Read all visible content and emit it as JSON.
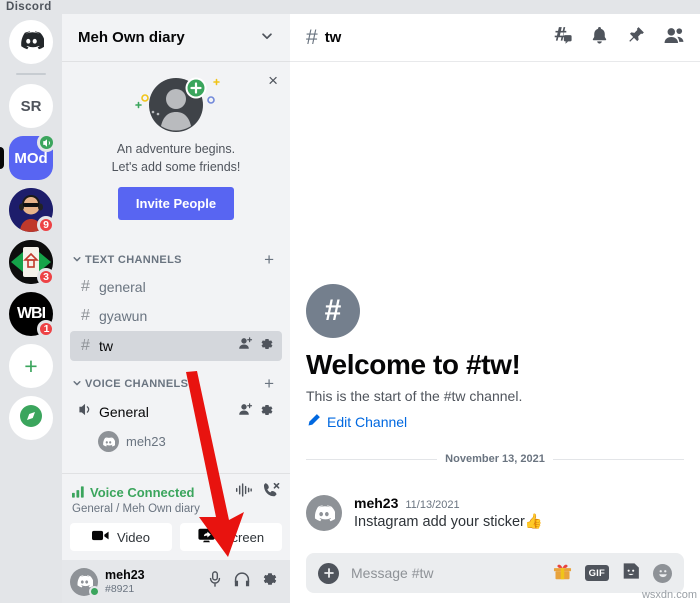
{
  "app": {
    "wordmark": "Discord",
    "watermark": "wsxdn.com"
  },
  "server_rail": {
    "home_icon": "discord-logo-icon",
    "items": [
      {
        "label": "SR",
        "style": "white",
        "badge": "",
        "voice_badge": false
      },
      {
        "label": "MOd",
        "style": "blurple",
        "badge": "",
        "voice_badge": true,
        "active": true
      },
      {
        "label": "",
        "style": "avatar-photo",
        "badge": "9",
        "voice_badge": false
      },
      {
        "label": "",
        "style": "avatar-home",
        "badge": "3",
        "voice_badge": false
      },
      {
        "label": "WBI",
        "style": "black",
        "badge": "1",
        "voice_badge": false
      }
    ],
    "add_server_label": "+",
    "explore_label": "compass-icon"
  },
  "sidebar": {
    "guild_name": "Meh Own diary",
    "guild_chevron": "chevron-down-icon",
    "promo": {
      "close": "×",
      "line1": "An adventure begins.",
      "line2": "Let's add some friends!",
      "button": "Invite People"
    },
    "categories": [
      {
        "label": "TEXT CHANNELS",
        "plus": "+",
        "channels": [
          {
            "name": "general",
            "prefix": "#",
            "active": false,
            "tools": false
          },
          {
            "name": "gyawun",
            "prefix": "#",
            "active": false,
            "tools": false
          },
          {
            "name": "tw",
            "prefix": "#",
            "active": true,
            "tools": true
          }
        ]
      },
      {
        "label": "VOICE CHANNELS",
        "plus": "+",
        "channels": [
          {
            "name": "General",
            "prefix": "speaker-icon",
            "active": false,
            "tools": true
          }
        ],
        "members": [
          {
            "name": "meh23"
          }
        ]
      }
    ],
    "voice_panel": {
      "status": "Voice Connected",
      "route": "General / Meh Own diary",
      "signal_icon": "signal-bars-icon",
      "ping_icon": "soundwave-icon",
      "disconnect_icon": "phone-hangup-icon",
      "buttons": [
        {
          "label": "Video",
          "icon": "camera-icon"
        },
        {
          "label": "Screen",
          "icon": "screen-share-icon"
        }
      ]
    },
    "user_panel": {
      "name": "meh23",
      "tag": "#8921",
      "icons": [
        "microphone-icon",
        "headphones-icon",
        "gear-icon"
      ]
    }
  },
  "main": {
    "header": {
      "hash": "#",
      "channel": "tw",
      "icons": [
        "threads-icon",
        "bell-icon",
        "pin-icon",
        "members-icon"
      ]
    },
    "welcome": {
      "icon": "#",
      "title": "Welcome to #tw!",
      "subtitle": "This is the start of the #tw channel.",
      "edit_link": "Edit Channel",
      "edit_icon": "pencil-icon"
    },
    "date_divider": "November 13, 2021",
    "message": {
      "author": "meh23",
      "timestamp": "11/13/2021",
      "body": "Instagram add your sticker",
      "emoji": "👍"
    },
    "composer": {
      "plus": "+",
      "placeholder": "Message #tw",
      "icons": [
        "gift-icon",
        "gif-icon",
        "sticker-icon",
        "emoji-icon"
      ],
      "gif_label": "GIF"
    }
  },
  "annotation": {
    "arrow": "red-arrow-pointing-to-screen-button",
    "color": "#e8130f"
  }
}
